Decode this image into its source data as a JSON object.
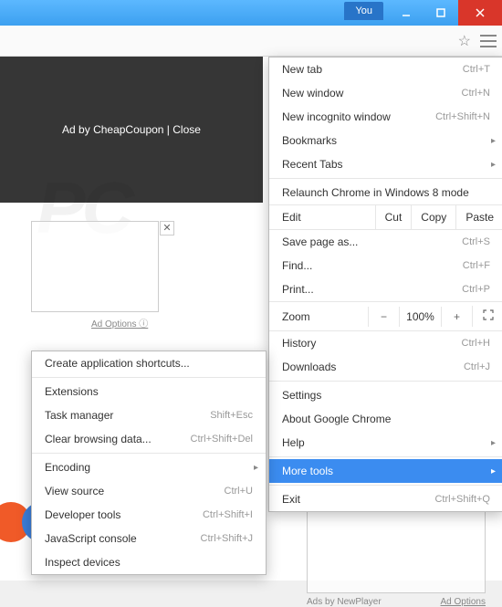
{
  "titlebar": {
    "you": "You"
  },
  "page": {
    "banner": "Ad by CheapCoupon | Close",
    "adopt1": "Ad Options",
    "ads_by": "Ads by NewPlayer",
    "adopt2": "Ad Options"
  },
  "menu": {
    "new_tab": {
      "label": "New tab",
      "shortcut": "Ctrl+T"
    },
    "new_window": {
      "label": "New window",
      "shortcut": "Ctrl+N"
    },
    "new_incognito": {
      "label": "New incognito window",
      "shortcut": "Ctrl+Shift+N"
    },
    "bookmarks": {
      "label": "Bookmarks"
    },
    "recent_tabs": {
      "label": "Recent Tabs"
    },
    "relaunch": {
      "label": "Relaunch Chrome in Windows 8 mode"
    },
    "edit": {
      "label": "Edit",
      "cut": "Cut",
      "copy": "Copy",
      "paste": "Paste"
    },
    "save_as": {
      "label": "Save page as...",
      "shortcut": "Ctrl+S"
    },
    "find": {
      "label": "Find...",
      "shortcut": "Ctrl+F"
    },
    "print": {
      "label": "Print...",
      "shortcut": "Ctrl+P"
    },
    "zoom": {
      "label": "Zoom",
      "minus": "−",
      "pct": "100%",
      "plus": "+"
    },
    "history": {
      "label": "History",
      "shortcut": "Ctrl+H"
    },
    "downloads": {
      "label": "Downloads",
      "shortcut": "Ctrl+J"
    },
    "settings": {
      "label": "Settings"
    },
    "about": {
      "label": "About Google Chrome"
    },
    "help": {
      "label": "Help"
    },
    "more_tools": {
      "label": "More tools"
    },
    "exit": {
      "label": "Exit",
      "shortcut": "Ctrl+Shift+Q"
    }
  },
  "submenu": {
    "create_shortcuts": {
      "label": "Create application shortcuts..."
    },
    "extensions": {
      "label": "Extensions"
    },
    "task_manager": {
      "label": "Task manager",
      "shortcut": "Shift+Esc"
    },
    "clear_data": {
      "label": "Clear browsing data...",
      "shortcut": "Ctrl+Shift+Del"
    },
    "encoding": {
      "label": "Encoding"
    },
    "view_source": {
      "label": "View source",
      "shortcut": "Ctrl+U"
    },
    "dev_tools": {
      "label": "Developer tools",
      "shortcut": "Ctrl+Shift+I"
    },
    "js_console": {
      "label": "JavaScript console",
      "shortcut": "Ctrl+Shift+J"
    },
    "inspect_devices": {
      "label": "Inspect devices"
    }
  }
}
